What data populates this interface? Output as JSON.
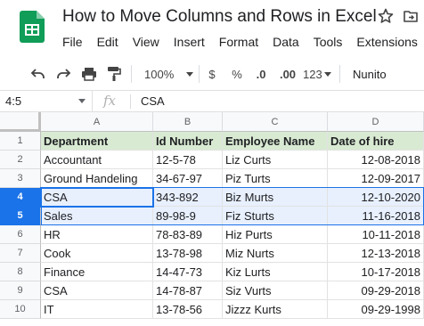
{
  "title": "How to Move Columns and Rows in Excel",
  "menu": [
    "File",
    "Edit",
    "View",
    "Insert",
    "Format",
    "Data",
    "Tools",
    "Extensions"
  ],
  "toolbar": {
    "zoom": "100%",
    "currency": "$",
    "percent": "%",
    "decrease_decimal": ".0",
    "increase_decimal": ".00",
    "more_formats": "123",
    "font": "Nunito"
  },
  "formula_bar": {
    "name_box": "4:5",
    "fx": "fx",
    "value": "CSA"
  },
  "columns": [
    "A",
    "B",
    "C",
    "D"
  ],
  "rows": [
    "1",
    "2",
    "3",
    "4",
    "5",
    "6",
    "7",
    "8",
    "9",
    "10"
  ],
  "selected_rows": [
    "4",
    "5"
  ],
  "headers": [
    "Department",
    "Id Number",
    "Employee Name",
    "Date of hire"
  ],
  "data_rows": [
    [
      "Accountant",
      "12-5-78",
      "Liz Curts",
      "12-08-2018"
    ],
    [
      "Ground Handeling",
      "34-67-97",
      "Piz Turts",
      "12-09-2017"
    ],
    [
      "CSA",
      "343-892",
      "Biz Murts",
      "12-10-2020"
    ],
    [
      "Sales",
      "89-98-9",
      "Fiz Sturts",
      "11-16-2018"
    ],
    [
      "HR",
      "78-83-89",
      "Hiz Purts",
      "10-11-2018"
    ],
    [
      "Cook",
      "13-78-98",
      "Miz Nurts",
      "12-13-2018"
    ],
    [
      "Finance",
      "14-47-73",
      "Kiz Lurts",
      "10-17-2018"
    ],
    [
      "CSA",
      "14-78-87",
      "Siz Vurts",
      "09-29-2018"
    ],
    [
      "IT",
      "13-78-56",
      "Jizzz Kurts",
      "09-29-1998"
    ]
  ],
  "colors": {
    "header_fill": "#d9ead3",
    "selection": "#1a73e8",
    "selection_fill": "#e8f0fe",
    "sheets_green": "#0f9d58"
  }
}
